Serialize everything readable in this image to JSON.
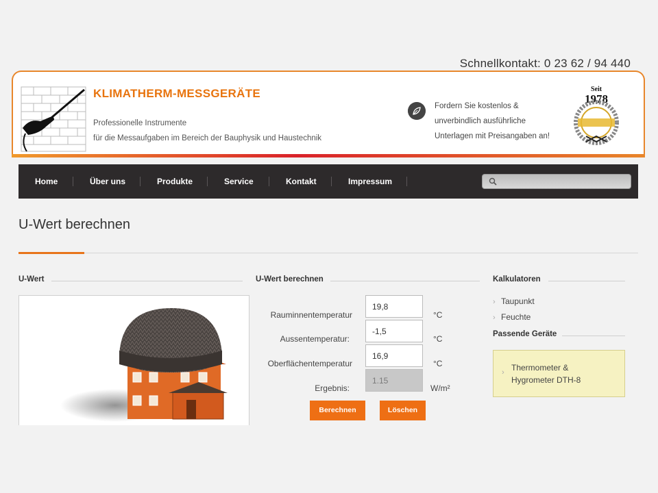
{
  "header": {
    "quick_contact": "Schnellkontakt: 0 23 62 / 94 440",
    "brand_name": "KLIMATHERM-MESSGERÄTE",
    "tagline_line1": "Professionelle Instrumente",
    "tagline_line2": "für die Messaufgaben im Bereich der Bauphysik und Haustechnik",
    "offer_line1": "Fordern Sie kostenlos &",
    "offer_line2": "unverbindlich ausführliche",
    "offer_line3": "Unterlagen mit Preisangaben an!",
    "seal_top": "Seit",
    "seal_year": "1978",
    "seal_ring_text": "KLIMATHERM MESSGERÄTE",
    "icon": "leaf-icon"
  },
  "nav": {
    "items": [
      {
        "label": "Home"
      },
      {
        "label": "Über uns"
      },
      {
        "label": "Produkte"
      },
      {
        "label": "Service"
      },
      {
        "label": "Kontakt"
      },
      {
        "label": "Impressum"
      }
    ],
    "search_value": "",
    "search_icon": "search-icon"
  },
  "page": {
    "title": "U-Wert berechnen"
  },
  "sections": {
    "image_heading": "U-Wert",
    "calculator_heading": "U-Wert berechnen",
    "sidebar_heading": "Kalkulatoren",
    "devices_heading": "Passende Geräte"
  },
  "calculator": {
    "room_label": "Rauminnentemperatur",
    "room_value": "19,8",
    "room_unit": "°C",
    "outside_label": "Aussentemperatur:",
    "outside_value": "-1,5",
    "outside_unit": "°C",
    "surface_label": "Oberflächentemperatur",
    "surface_value": "16,9",
    "surface_unit": "°C",
    "result_label": "Ergebnis:",
    "result_value": "1.15",
    "result_unit": "W/m²",
    "calculate_button": "Berechnen",
    "clear_button": "Löschen"
  },
  "sidebar": {
    "calculators": [
      {
        "label": "Taupunkt"
      },
      {
        "label": "Feuchte"
      }
    ],
    "device_line1": "Thermometer &",
    "device_line2": "Hygrometer DTH-8"
  },
  "colors": {
    "accent": "#e8741a",
    "nav_bg": "#2d2a2b",
    "highlight_box": "#f6f2c2"
  }
}
